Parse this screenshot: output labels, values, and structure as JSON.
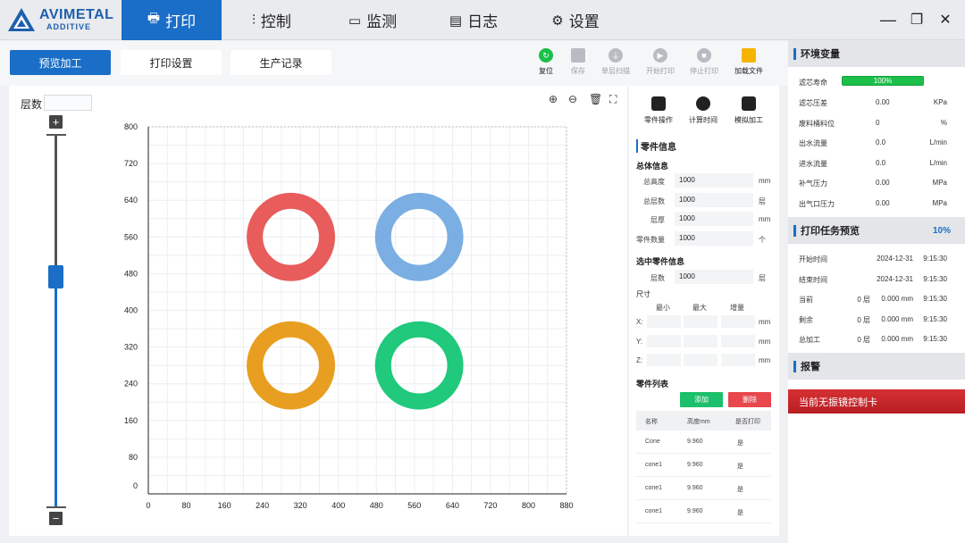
{
  "app": {
    "logo_line1": "AVIMETAL",
    "logo_line2": "ADDITIVE",
    "tabs": [
      {
        "label": "打印",
        "icon": "printer-icon",
        "active": true
      },
      {
        "label": "控制",
        "icon": "sliders-icon",
        "active": false
      },
      {
        "label": "监测",
        "icon": "monitor-icon",
        "active": false
      },
      {
        "label": "日志",
        "icon": "calendar-icon",
        "active": false
      },
      {
        "label": "设置",
        "icon": "gear-icon",
        "active": false
      }
    ],
    "window_controls": {
      "minimize": "—",
      "maximize": "❐",
      "close": "✕"
    },
    "accent_color": "#1a6ec7"
  },
  "toolbar": {
    "preview_label": "预览加工",
    "print_settings_label": "打印设置",
    "production_log_label": "生产记录",
    "tools": [
      {
        "label": "复位",
        "icon": "reset-icon",
        "enabled": true
      },
      {
        "label": "保存",
        "icon": "save-icon",
        "enabled": false
      },
      {
        "label": "单层扫描",
        "icon": "scan-icon",
        "enabled": false
      },
      {
        "label": "开始打印",
        "icon": "play-icon",
        "enabled": false
      },
      {
        "label": "停止打印",
        "icon": "stop-icon",
        "enabled": false
      },
      {
        "label": "加载文件",
        "icon": "folder-icon",
        "enabled": true
      }
    ]
  },
  "canvas": {
    "layer_label": "层数",
    "layer_value": "",
    "slider_plus": "+",
    "slider_minus": "−",
    "slider_level": 0.62,
    "tools": [
      "zoom-in-icon",
      "zoom-out-icon",
      "trash-icon",
      "fit-icon"
    ]
  },
  "chart_data": {
    "type": "scatter",
    "xlim": [
      0,
      880
    ],
    "ylim": [
      0,
      800
    ],
    "x_ticks": [
      "0",
      "80",
      "160",
      "240",
      "320",
      "400",
      "480",
      "560",
      "640",
      "720",
      "800",
      "880"
    ],
    "y_ticks": [
      "0",
      "80",
      "160",
      "240",
      "320",
      "400",
      "480",
      "560",
      "640",
      "720",
      "800"
    ],
    "grid": true,
    "rings": [
      {
        "cx": 300,
        "cy": 560,
        "r_outer": 93,
        "r_inner": 59,
        "color": "#e85c5c"
      },
      {
        "cx": 570,
        "cy": 560,
        "r_outer": 93,
        "r_inner": 59,
        "color": "#7baee2"
      },
      {
        "cx": 300,
        "cy": 280,
        "r_outer": 93,
        "r_inner": 59,
        "color": "#e89e20"
      },
      {
        "cx": 570,
        "cy": 280,
        "r_outer": 93,
        "r_inner": 59,
        "color": "#20c97b"
      }
    ]
  },
  "part_panel": {
    "ops": [
      {
        "label": "零件操作",
        "icon": "cube-icon"
      },
      {
        "label": "计算时间",
        "icon": "clock-icon"
      },
      {
        "label": "模拟加工",
        "icon": "simulate-icon"
      }
    ],
    "section_title": "零件信息",
    "overall_title": "总体信息",
    "overall": [
      {
        "label": "总高度",
        "value": "1000",
        "unit": "mm"
      },
      {
        "label": "总层数",
        "value": "1000",
        "unit": "层"
      },
      {
        "label": "层厚",
        "value": "1000",
        "unit": "mm"
      },
      {
        "label": "零件数量",
        "value": "1000",
        "unit": "个"
      }
    ],
    "selected_title": "选中零件信息",
    "selected_layers": {
      "label": "层数",
      "value": "1000",
      "unit": "层"
    },
    "size_title": "尺寸",
    "size_heads": [
      "最小",
      "最大",
      "增量"
    ],
    "size_axes": [
      {
        "axis": "X:",
        "unit": "mm"
      },
      {
        "axis": "Y:",
        "unit": "mm"
      },
      {
        "axis": "Z:",
        "unit": "mm"
      }
    ],
    "list_title": "零件列表",
    "add_label": "添加",
    "delete_label": "删除",
    "table_headers": [
      "名称",
      "高度mm",
      "是否打印"
    ],
    "table_rows": [
      [
        "Cone",
        "9.960",
        "是"
      ],
      [
        "cone1",
        "9.960",
        "是"
      ],
      [
        "cone1",
        "9.960",
        "是"
      ],
      [
        "cone1",
        "9.960",
        "是"
      ]
    ]
  },
  "right_panel": {
    "env_title": "环境变量",
    "filter_life_label": "滤芯寿命",
    "filter_life_value": "100%",
    "env_rows": [
      {
        "label": "滤芯压差",
        "value": "0.00",
        "unit": "KPa"
      },
      {
        "label": "废料桶料位",
        "value": "0",
        "unit": "%"
      },
      {
        "label": "出水流量",
        "value": "0.0",
        "unit": "L/min"
      },
      {
        "label": "进水流量",
        "value": "0.0",
        "unit": "L/min"
      },
      {
        "label": "补气压力",
        "value": "0.00",
        "unit": "MPa"
      },
      {
        "label": "出气口压力",
        "value": "0.00",
        "unit": "MPa"
      }
    ],
    "task_title": "打印任务预览",
    "task_percent": "10%",
    "task_rows": [
      {
        "label": "开始时间",
        "a": "",
        "b": "2024-12-31",
        "c": "9:15:30"
      },
      {
        "label": "结束时间",
        "a": "",
        "b": "2024-12-31",
        "c": "9:15:30"
      },
      {
        "label": "当前",
        "a": "0 层",
        "b": "0.000 mm",
        "c": "9:15:30"
      },
      {
        "label": "剩余",
        "a": "0 层",
        "b": "0.000 mm",
        "c": "9:15:30"
      },
      {
        "label": "总加工",
        "a": "0 层",
        "b": "0.000 mm",
        "c": "9:15:30"
      }
    ],
    "alarm_title": "报警",
    "alarm_message": "当前无振镜控制卡"
  }
}
